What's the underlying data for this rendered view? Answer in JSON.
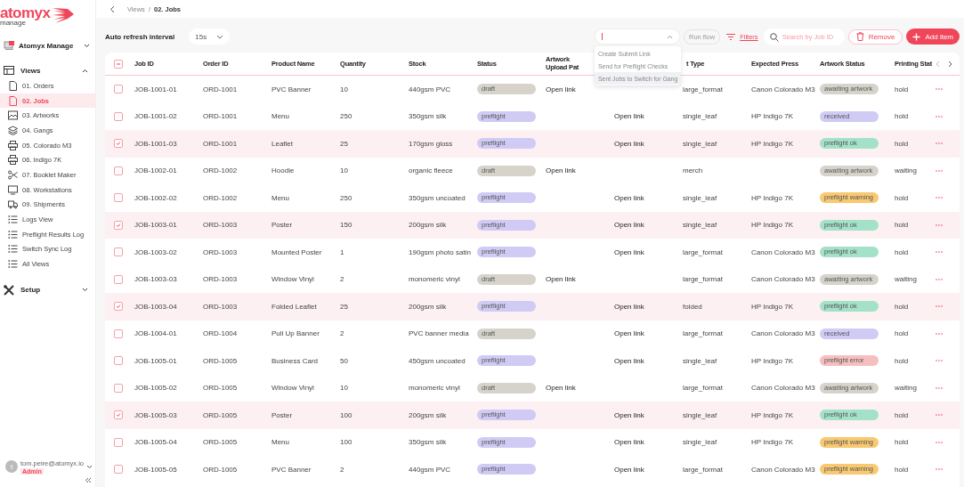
{
  "logo": {
    "name": "atomyx",
    "subtitle": "manage"
  },
  "workspace": {
    "name": "Atomyx Manage"
  },
  "nav": [
    {
      "label": "Views",
      "expanded": true,
      "children": [
        {
          "label": "01. Orders",
          "selected": false
        },
        {
          "label": "02. Jobs",
          "selected": true
        },
        {
          "label": "03. Artworks",
          "selected": false
        },
        {
          "label": "04. Gangs",
          "selected": false
        },
        {
          "label": "05. Colorado M3",
          "selected": false
        },
        {
          "label": "06. Indigo 7K",
          "selected": false
        },
        {
          "label": "07. Booklet Maker",
          "selected": false
        },
        {
          "label": "08. Workstations",
          "selected": false
        },
        {
          "label": "09. Shipments",
          "selected": false
        },
        {
          "label": "Logs View",
          "selected": false
        },
        {
          "label": "Preflight Results Log",
          "selected": false
        },
        {
          "label": "Switch Sync Log",
          "selected": false
        },
        {
          "label": "All Views",
          "selected": false
        }
      ]
    },
    {
      "label": "Setup",
      "expanded": false
    }
  ],
  "user": {
    "initial": "t",
    "email": "tom.peire@atomyx.io",
    "role": "Admin"
  },
  "breadcrumb": {
    "items": [
      "Views",
      "02. Jobs"
    ],
    "separator": "/"
  },
  "toolbar": {
    "refresh_label": "Auto refresh interval",
    "refresh_value": "15s",
    "action_select": {
      "expanded": true,
      "options": [
        {
          "label": "Create Submit Link",
          "selected": false
        },
        {
          "label": "Send for Preflight Checks",
          "selected": false
        },
        {
          "label": "Sent Jobs to Switch for Gang",
          "selected": true
        }
      ]
    },
    "run_flow": "Run flow",
    "filters": "Filters",
    "search_placeholder": "Search by Job ID",
    "remove": "Remove",
    "add": "Add item"
  },
  "table": {
    "select_all": {
      "indeterminate": true
    },
    "columns": [
      "Job ID",
      "Order ID",
      "Product Name",
      "Quantity",
      "Stock",
      "Status",
      "Artwork Upload Pat",
      "t Type",
      "Expected Press",
      "Artwork Status",
      "Printing Stat"
    ],
    "rows": [
      {
        "selected": false,
        "job_id": "JOB-1001-01",
        "order_id": "ORD-1001",
        "product_name": "PVC Banner",
        "quantity": "10",
        "stock": "440gsm PVC",
        "status": {
          "text": "draft",
          "color": "#d6d3cb"
        },
        "artwork_upload_path": "Open link",
        "type": "large_format",
        "expected_press": "Canon Colorado M3",
        "artwork_status": {
          "text": "awaiting artwork",
          "color": "#d6d3cb"
        },
        "printing_status": "hold"
      },
      {
        "selected": false,
        "job_id": "JOB-1001-02",
        "order_id": "ORD-1001",
        "product_name": "Menu",
        "quantity": "250",
        "stock": "350gsm silk",
        "status": {
          "text": "preflight",
          "color": "#cfcbf5"
        },
        "column_8": "Open link",
        "type": "single_leaf",
        "expected_press": "HP Indigo 7K",
        "artwork_status": {
          "text": "received",
          "color": "#cfcbf5"
        },
        "printing_status": "hold"
      },
      {
        "selected": true,
        "job_id": "JOB-1001-03",
        "order_id": "ORD-1001",
        "product_name": "Leaflet",
        "quantity": "25",
        "stock": "170gsm gloss",
        "status": {
          "text": "preflight",
          "color": "#cfcbf5"
        },
        "column_8": "Open link",
        "type": "single_leaf",
        "expected_press": "HP Indigo 7K",
        "artwork_status": {
          "text": "preflight ok",
          "color": "#a3e2c9"
        },
        "printing_status": "hold"
      },
      {
        "selected": false,
        "job_id": "JOB-1002-01",
        "order_id": "ORD-1002",
        "product_name": "Hoodie",
        "quantity": "10",
        "stock": "organic fleece",
        "status": {
          "text": "draft",
          "color": "#d6d3cb"
        },
        "artwork_upload_path": "Open link",
        "type": "merch",
        "artwork_status": {
          "text": "awaiting artwork",
          "color": "#d6d3cb"
        },
        "printing_status": "waiting"
      },
      {
        "selected": false,
        "job_id": "JOB-1002-02",
        "order_id": "ORD-1002",
        "product_name": "Menu",
        "quantity": "250",
        "stock": "350gsm uncoated",
        "status": {
          "text": "preflight",
          "color": "#cfcbf5"
        },
        "column_8": "Open link",
        "type": "single_leaf",
        "expected_press": "HP Indigo 7K",
        "artwork_status": {
          "text": "preflight warning",
          "color": "#f8c971"
        },
        "printing_status": "hold"
      },
      {
        "selected": true,
        "job_id": "JOB-1003-01",
        "order_id": "ORD-1003",
        "product_name": "Poster",
        "quantity": "150",
        "stock": "200gsm silk",
        "status": {
          "text": "preflight",
          "color": "#cfcbf5"
        },
        "column_8": "Open link",
        "type": "single_leaf",
        "expected_press": "HP Indigo 7K",
        "artwork_status": {
          "text": "preflight ok",
          "color": "#a3e2c9"
        },
        "printing_status": "hold"
      },
      {
        "selected": false,
        "job_id": "JOB-1003-02",
        "order_id": "ORD-1003",
        "product_name": "Mounted Poster",
        "quantity": "1",
        "stock": "190gsm photo satin",
        "status": {
          "text": "preflight",
          "color": "#cfcbf5"
        },
        "column_8": "Open link",
        "type": "large_format",
        "expected_press": "Canon Colorado M3",
        "artwork_status": {
          "text": "preflight ok",
          "color": "#a3e2c9"
        },
        "printing_status": "hold"
      },
      {
        "selected": false,
        "job_id": "JOB-1003-03",
        "order_id": "ORD-1003",
        "product_name": "Window Vinyl",
        "quantity": "2",
        "stock": "monomeric vinyl",
        "status": {
          "text": "draft",
          "color": "#d6d3cb"
        },
        "artwork_upload_path": "Open link",
        "type": "large_format",
        "expected_press": "Canon Colorado M3",
        "artwork_status": {
          "text": "awaiting artwork",
          "color": "#d6d3cb"
        },
        "printing_status": "waiting"
      },
      {
        "selected": true,
        "job_id": "JOB-1003-04",
        "order_id": "ORD-1003",
        "product_name": "Folded Leaflet",
        "quantity": "25",
        "stock": "200gsm silk",
        "status": {
          "text": "preflight",
          "color": "#cfcbf5"
        },
        "column_8": "Open link",
        "type": "folded",
        "expected_press": "HP Indigo 7K",
        "artwork_status": {
          "text": "preflight ok",
          "color": "#a3e2c9"
        },
        "printing_status": "hold"
      },
      {
        "selected": false,
        "job_id": "JOB-1004-01",
        "order_id": "ORD-1004",
        "product_name": "Pull Up Banner",
        "quantity": "2",
        "stock": "PVC banner media",
        "status": {
          "text": "draft",
          "color": "#d6d3cb"
        },
        "column_8": "Open link",
        "type": "large_format",
        "expected_press": "Canon Colorado M3",
        "artwork_status": {
          "text": "received",
          "color": "#cfcbf5"
        },
        "printing_status": "hold"
      },
      {
        "selected": false,
        "job_id": "JOB-1005-01",
        "order_id": "ORD-1005",
        "product_name": "Business Card",
        "quantity": "50",
        "stock": "450gsm uncoated",
        "status": {
          "text": "preflight",
          "color": "#cfcbf5"
        },
        "column_8": "Open link",
        "type": "single_leaf",
        "expected_press": "HP Indigo 7K",
        "artwork_status": {
          "text": "preflight error",
          "color": "#f6bfbf"
        },
        "printing_status": "hold"
      },
      {
        "selected": false,
        "job_id": "JOB-1005-02",
        "order_id": "ORD-1005",
        "product_name": "Window Vinyl",
        "quantity": "10",
        "stock": "monomeric vinyl",
        "status": {
          "text": "draft",
          "color": "#d6d3cb"
        },
        "artwork_upload_path": "Open link",
        "type": "large_format",
        "expected_press": "Canon Colorado M3",
        "artwork_status": {
          "text": "awaiting artwork",
          "color": "#d6d3cb"
        },
        "printing_status": "waiting"
      },
      {
        "selected": true,
        "job_id": "JOB-1005-03",
        "order_id": "ORD-1005",
        "product_name": "Poster",
        "quantity": "100",
        "stock": "200gsm silk",
        "status": {
          "text": "preflight",
          "color": "#cfcbf5"
        },
        "column_8": "Open link",
        "type": "single_leaf",
        "expected_press": "HP Indigo 7K",
        "artwork_status": {
          "text": "preflight ok",
          "color": "#a3e2c9"
        },
        "printing_status": "hold"
      },
      {
        "selected": false,
        "job_id": "JOB-1005-04",
        "order_id": "ORD-1005",
        "product_name": "Menu",
        "quantity": "100",
        "stock": "350gsm silk",
        "status": {
          "text": "preflight",
          "color": "#cfcbf5"
        },
        "column_8": "Open link",
        "type": "single_leaf",
        "expected_press": "HP Indigo 7K",
        "artwork_status": {
          "text": "preflight warning",
          "color": "#f8c971"
        },
        "printing_status": "hold"
      },
      {
        "selected": false,
        "job_id": "JOB-1005-05",
        "order_id": "ORD-1005",
        "product_name": "PVC Banner",
        "quantity": "2",
        "stock": "440gsm PVC",
        "status": {
          "text": "preflight",
          "color": "#cfcbf5"
        },
        "column_8": "Open link",
        "type": "large_format",
        "expected_press": "Canon Colorado M3",
        "artwork_status": {
          "text": "preflight warning",
          "color": "#f8c971"
        },
        "printing_status": "hold"
      }
    ]
  }
}
